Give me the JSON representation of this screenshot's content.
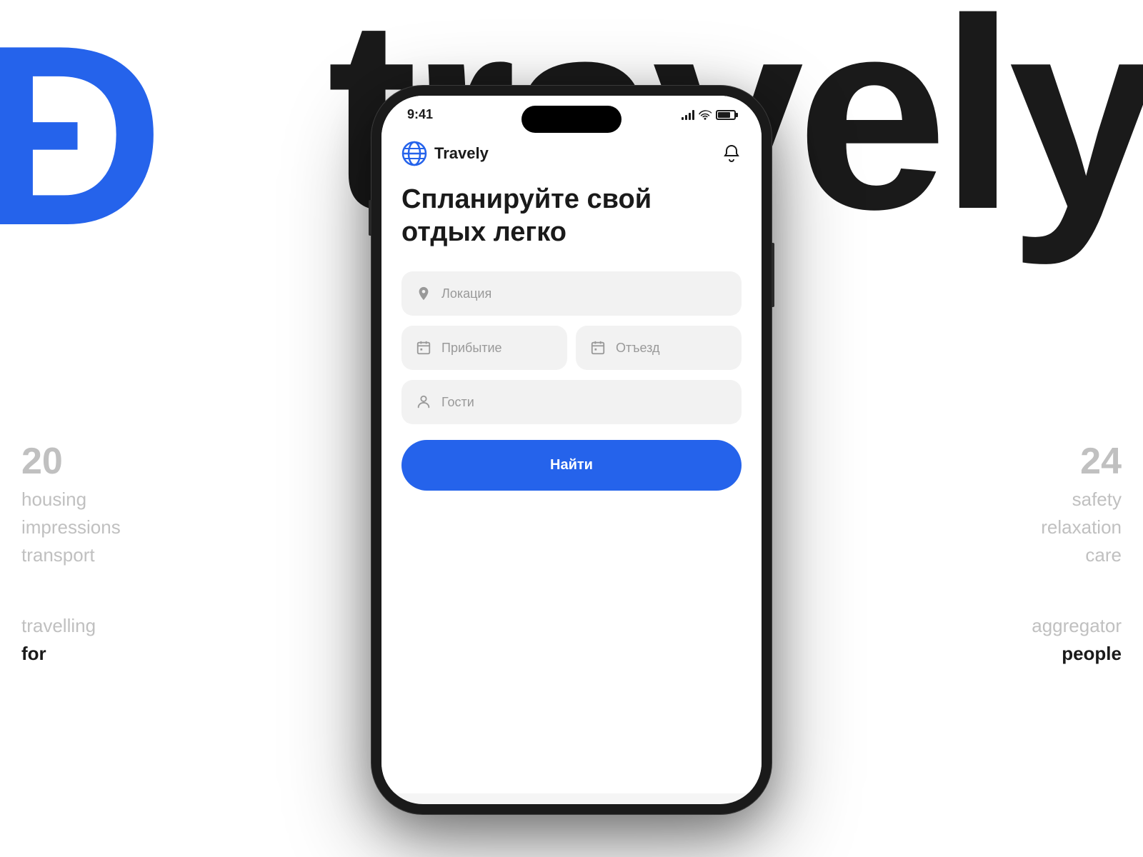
{
  "brand": {
    "background_word": "travely",
    "logo_symbol": "Ɖ",
    "app_name": "Travely",
    "accent_color": "#2563eb"
  },
  "side_left": {
    "number": "20",
    "items": [
      "housing",
      "impressions",
      "transport"
    ],
    "bottom_label": "travelling",
    "bottom_highlight": "for"
  },
  "side_right": {
    "number": "24",
    "items": [
      "safety",
      "relaxation",
      "care"
    ],
    "bottom_label": "aggregator",
    "bottom_highlight": "people"
  },
  "phone": {
    "status_bar": {
      "time": "9:41"
    },
    "header": {
      "app_name": "Travely",
      "notification_icon": "bell"
    },
    "main_heading": "Спланируйте свой отдых легко",
    "form": {
      "location_placeholder": "Локация",
      "arrival_placeholder": "Прибытие",
      "departure_placeholder": "Отъезд",
      "guests_placeholder": "Гости",
      "search_button_label": "Найти"
    }
  }
}
